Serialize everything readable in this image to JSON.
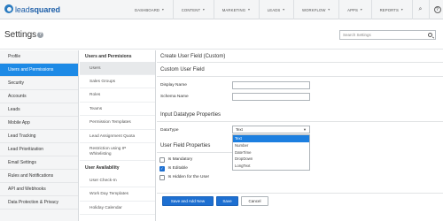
{
  "logo": {
    "text_light": "lead",
    "text_bold": "squared"
  },
  "nav": {
    "items": [
      {
        "label": "DASHBOARD"
      },
      {
        "label": "CONTENT"
      },
      {
        "label": "MARKETING"
      },
      {
        "label": "LEADS"
      },
      {
        "label": "WORKFLOW"
      },
      {
        "label": "APPS"
      },
      {
        "label": "REPORTS"
      }
    ],
    "caret": "▼",
    "search_glyph": "⌕",
    "help_glyph": "?"
  },
  "header": {
    "title": "Settings",
    "info_glyph": "?",
    "search_placeholder": "Search Settings"
  },
  "sidebar": {
    "items": [
      {
        "label": "Profile",
        "active": false
      },
      {
        "label": "Users and Permissions",
        "active": true
      },
      {
        "label": "Security",
        "active": false
      },
      {
        "label": "Accounts",
        "active": false
      },
      {
        "label": "Leads",
        "active": false
      },
      {
        "label": "Mobile App",
        "active": false
      },
      {
        "label": "Lead Tracking",
        "active": false
      },
      {
        "label": "Lead Prioritization",
        "active": false
      },
      {
        "label": "Email Settings",
        "active": false
      },
      {
        "label": "Rules and Notifications",
        "active": false
      },
      {
        "label": "API and Webhooks",
        "active": false
      },
      {
        "label": "Data Protection & Privacy",
        "active": false
      }
    ]
  },
  "subnav": {
    "heading1": "Users and Permisions",
    "items1": [
      {
        "label": "Users",
        "active": true
      },
      {
        "label": "Sales Groups",
        "active": false
      },
      {
        "label": "Roles",
        "active": false
      },
      {
        "label": "Teams",
        "active": false
      },
      {
        "label": "Permission Templates",
        "active": false
      },
      {
        "label": "Lead Assignment Quota",
        "active": false
      },
      {
        "label": "Restriction using IP Whitelisting",
        "active": false
      }
    ],
    "heading2": "User Availability",
    "items2": [
      {
        "label": "User Check-In"
      },
      {
        "label": "Work Day Templates"
      },
      {
        "label": "Holiday Calendar"
      }
    ]
  },
  "main": {
    "page_heading": "Create User Field (Custom)",
    "custom_field_heading": "Custom User Field",
    "display_name_label": "Display Name",
    "display_name_value": "",
    "schema_name_label": "Schema Name",
    "schema_name_value": "",
    "input_datatype_heading": "Input Datatype Properties",
    "datatype_label": "DataType",
    "datatype_selected": "Text",
    "datatype_options": [
      "Text",
      "Number",
      "DateTime",
      "DropDown",
      "LongText"
    ],
    "user_field_heading": "User Field Properties",
    "checkboxes": [
      {
        "label": "Is Mandatory",
        "checked": false
      },
      {
        "label": "Is Editable",
        "checked": true
      },
      {
        "label": "Is Hidden for the User",
        "checked": false
      }
    ],
    "check_glyph": "✓"
  },
  "buttons": {
    "save_and_add_new": "Save and Add New",
    "save": "Save",
    "cancel": "Cancel"
  },
  "colors": {
    "accent": "#1d8ae6",
    "primary_button": "#1d6fd1",
    "brand": "#1c5ea8"
  }
}
